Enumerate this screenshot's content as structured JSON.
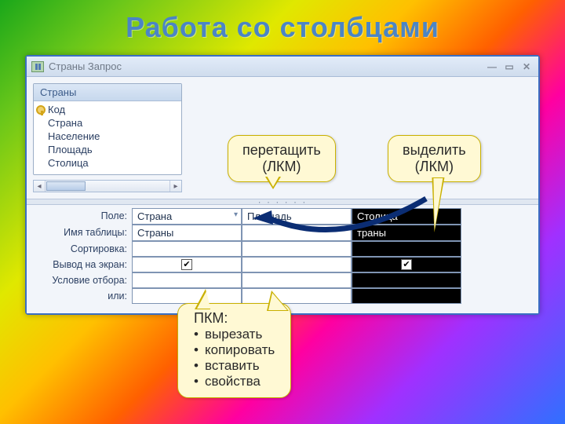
{
  "slide_title": "Работа со столбцами",
  "window": {
    "title": "Страны Запрос"
  },
  "table_box": {
    "header": "Страны",
    "fields": [
      "Код",
      "Страна",
      "Население",
      "Площадь",
      "Столица"
    ]
  },
  "grid": {
    "row_labels": [
      "Поле:",
      "Имя таблицы:",
      "Сортировка:",
      "Вывод на экран:",
      "Условие отбора:",
      "или:"
    ],
    "cols": [
      {
        "field": "Страна",
        "table": "Страны",
        "checked": true,
        "selected": false
      },
      {
        "field": "Площадь",
        "table": "",
        "checked": false,
        "selected": false
      },
      {
        "field": "Столица",
        "table": "траны",
        "checked": true,
        "selected": true
      }
    ]
  },
  "callouts": {
    "drag": {
      "l1": "перетащить",
      "l2": "(ЛКМ)"
    },
    "select": {
      "l1": "выделить",
      "l2": "(ЛКМ)"
    },
    "pkm": {
      "title": "ПКМ:",
      "items": [
        "вырезать",
        "копировать",
        "вставить",
        "свойства"
      ]
    }
  }
}
